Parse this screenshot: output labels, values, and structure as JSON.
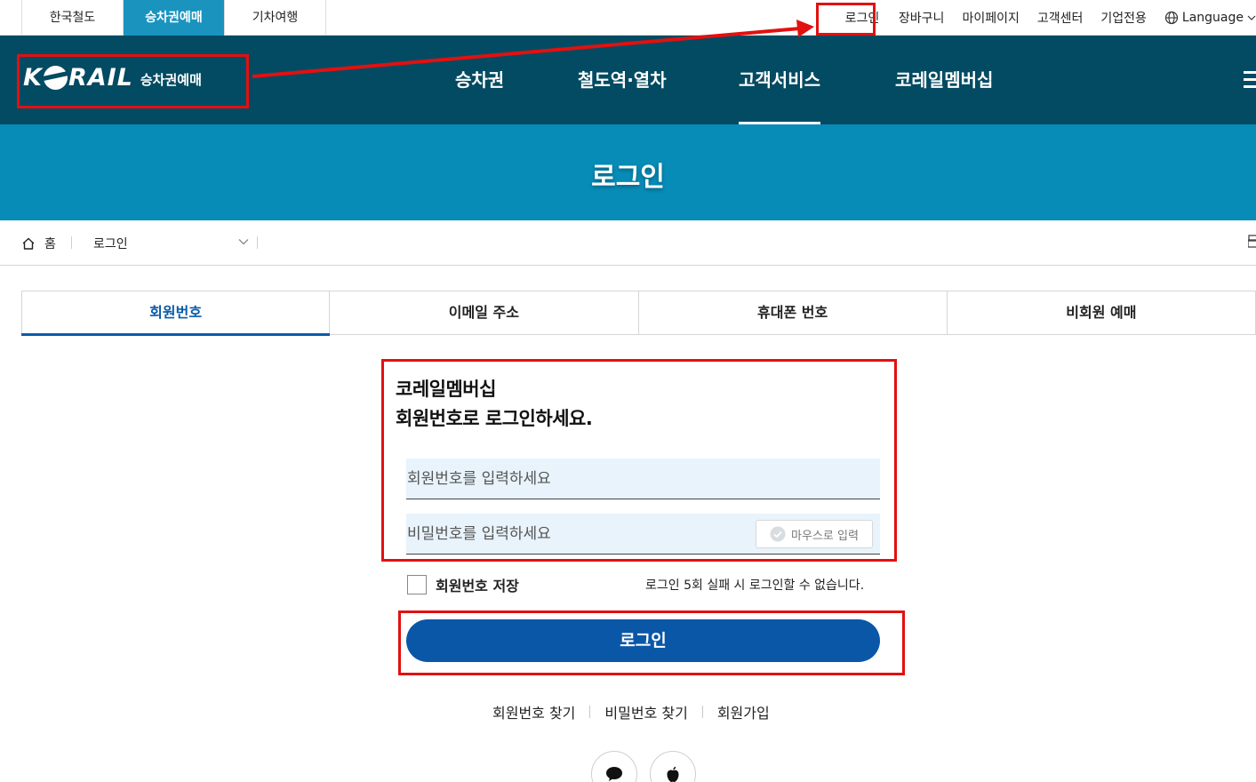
{
  "site_tabs": [
    {
      "label": "한국철도"
    },
    {
      "label": "승차권예매"
    },
    {
      "label": "기차여행"
    }
  ],
  "util_links": [
    {
      "label": "로그인"
    },
    {
      "label": "장바구니"
    },
    {
      "label": "마이페이지"
    },
    {
      "label": "고객센터"
    },
    {
      "label": "기업전용"
    },
    {
      "label": "Language"
    }
  ],
  "logo": {
    "brand": "KRAIL",
    "subtitle": "승차권예매"
  },
  "main_nav": [
    {
      "label": "승차권"
    },
    {
      "label": "철도역·열차"
    },
    {
      "label": "고객서비스"
    },
    {
      "label": "코레일멤버십"
    }
  ],
  "banner": {
    "title": "로그인"
  },
  "breadcrumb": {
    "home": "홈",
    "current": "로그인"
  },
  "login_tabs": [
    {
      "label": "회원번호"
    },
    {
      "label": "이메일 주소"
    },
    {
      "label": "휴대폰 번호"
    },
    {
      "label": "비회원 예매"
    }
  ],
  "form": {
    "heading_line1": "코레일멤버십",
    "heading_line2": "회원번호로 로그인하세요.",
    "member_placeholder": "회원번호를 입력하세요",
    "password_placeholder": "비밀번호를 입력하세요",
    "mouse_input_label": "마우스로 입력",
    "save_label": "회원번호 저장",
    "warning": "로그인 5회 실패 시 로그인할 수 없습니다.",
    "login_button": "로그인"
  },
  "helper_links": [
    {
      "label": "회원번호 찾기"
    },
    {
      "label": "비밀번호 찾기"
    },
    {
      "label": "회원가입"
    }
  ],
  "sns": [
    {
      "icon": "chat-bubble-icon"
    },
    {
      "icon": "apple-icon"
    }
  ],
  "colors": {
    "nav_bg": "#034b62",
    "banner_bg": "#078cb8",
    "active_site_tab": "#1a94bf",
    "primary_button": "#0a57a8",
    "highlight": "#e31010"
  }
}
